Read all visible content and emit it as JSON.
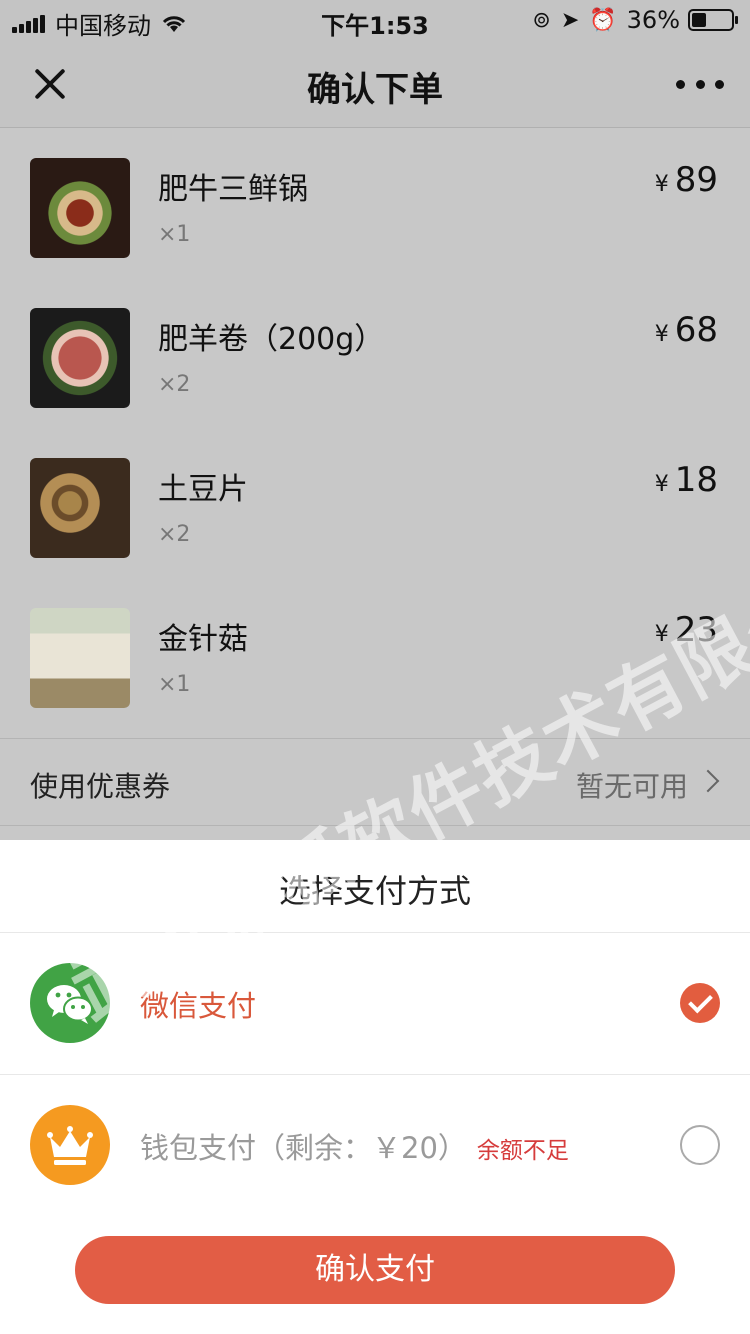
{
  "status_bar": {
    "carrier": "中国移动",
    "time": "下午1:53",
    "battery": "36%"
  },
  "nav": {
    "title": "确认下单"
  },
  "items": [
    {
      "name": "肥牛三鲜锅",
      "qty": "×1",
      "currency": "¥",
      "price": "89"
    },
    {
      "name": "肥羊卷（200g）",
      "qty": "×2",
      "currency": "¥",
      "price": "68"
    },
    {
      "name": "土豆片",
      "qty": "×2",
      "currency": "¥",
      "price": "18"
    },
    {
      "name": "金针菇",
      "qty": "×1",
      "currency": "¥",
      "price": "23"
    }
  ],
  "coupon": {
    "label": "使用优惠券",
    "value": "暂无可用"
  },
  "payment": {
    "title": "选择支付方式",
    "options": [
      {
        "label": "微信支付",
        "selected": true
      },
      {
        "label": "钱包支付（剩余：￥20）",
        "note": "余额不足",
        "selected": false
      }
    ],
    "confirm_label": "确认支付"
  },
  "watermark": "武汉派狐软件技术有限公司",
  "colors": {
    "accent": "#e25d45",
    "wechat": "#41a345",
    "wallet": "#f59a20",
    "warning": "#d63c3c"
  }
}
